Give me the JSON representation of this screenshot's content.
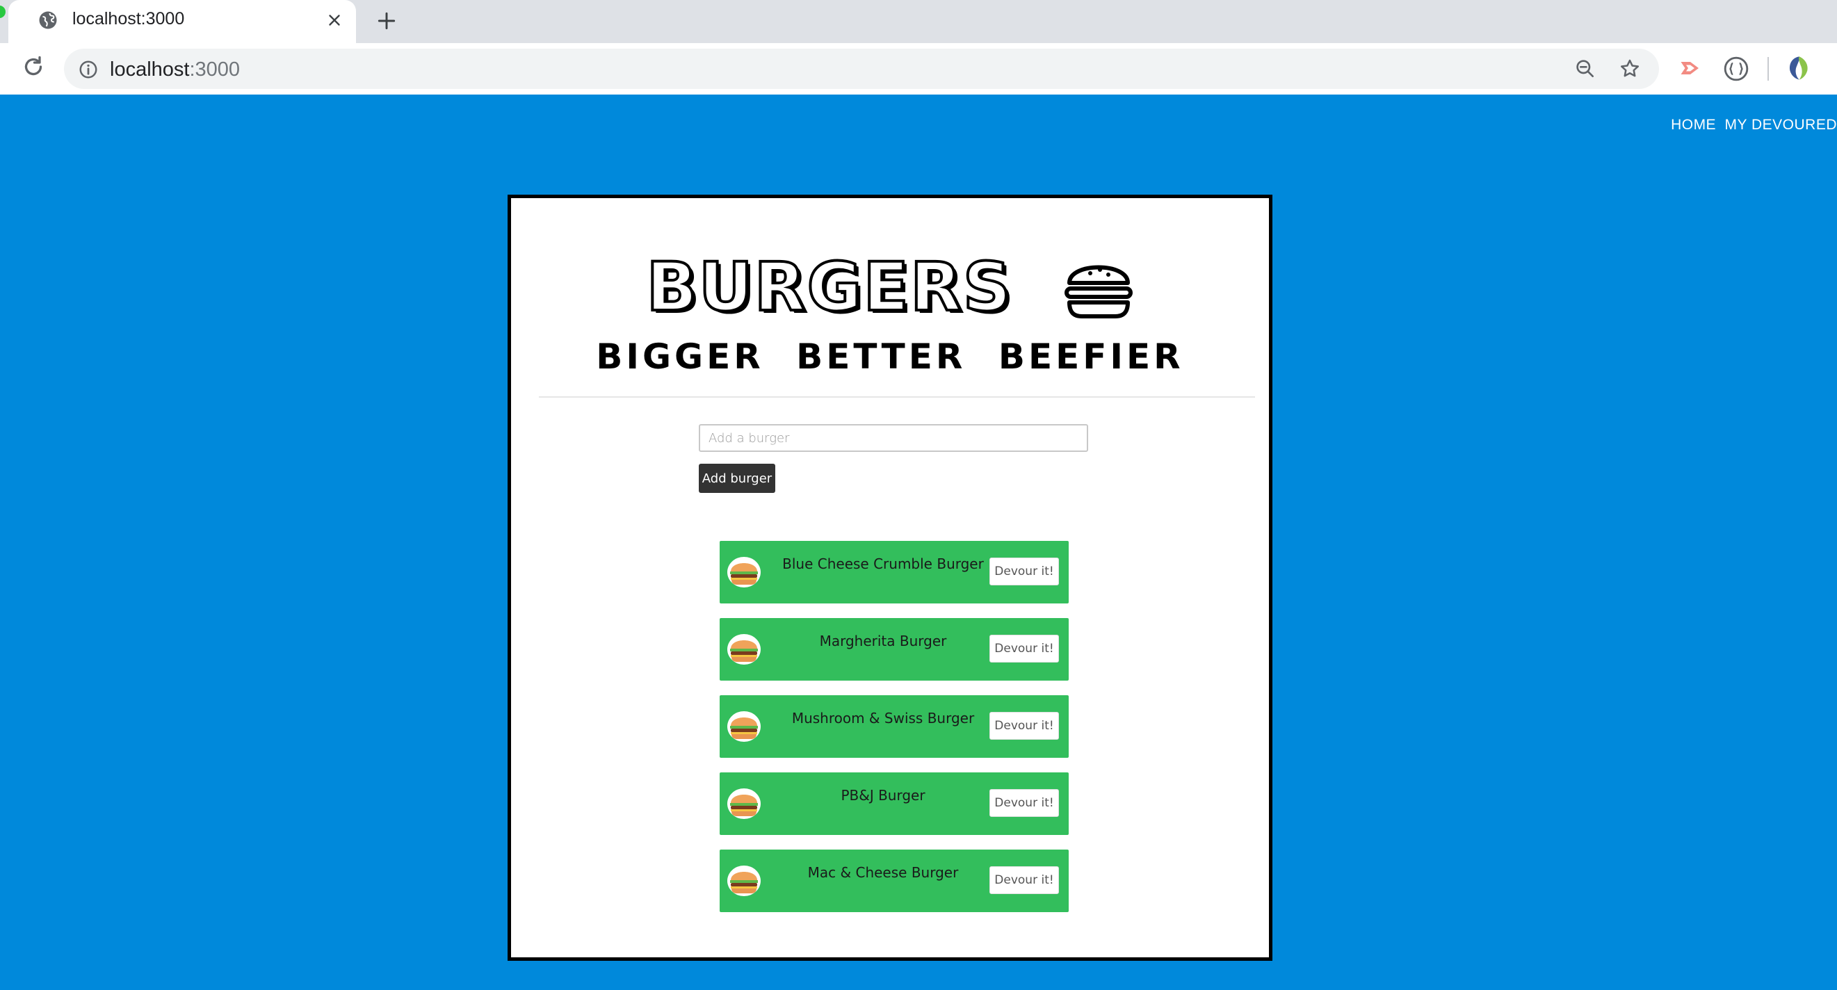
{
  "browser": {
    "tab_title": "localhost:3000",
    "url_host": "localhost",
    "url_port": ":3000"
  },
  "nav": {
    "home": "HOME",
    "devoured": "MY DEVOURED"
  },
  "header": {
    "title": "BURGERS",
    "tagline": "BIGGER BETTER BEEFIER"
  },
  "form": {
    "placeholder": "Add a burger",
    "button_label": "Add burger"
  },
  "burgers": [
    {
      "name": "Blue Cheese Crumble Burger",
      "action": "Devour it!"
    },
    {
      "name": "Margherita Burger",
      "action": "Devour it!"
    },
    {
      "name": "Mushroom & Swiss Burger",
      "action": "Devour it!"
    },
    {
      "name": "PB&J Burger",
      "action": "Devour it!"
    },
    {
      "name": "Mac & Cheese Burger",
      "action": "Devour it!"
    }
  ],
  "colors": {
    "background": "#0089DB",
    "item": "#33BE5C",
    "add_button": "#333333"
  }
}
